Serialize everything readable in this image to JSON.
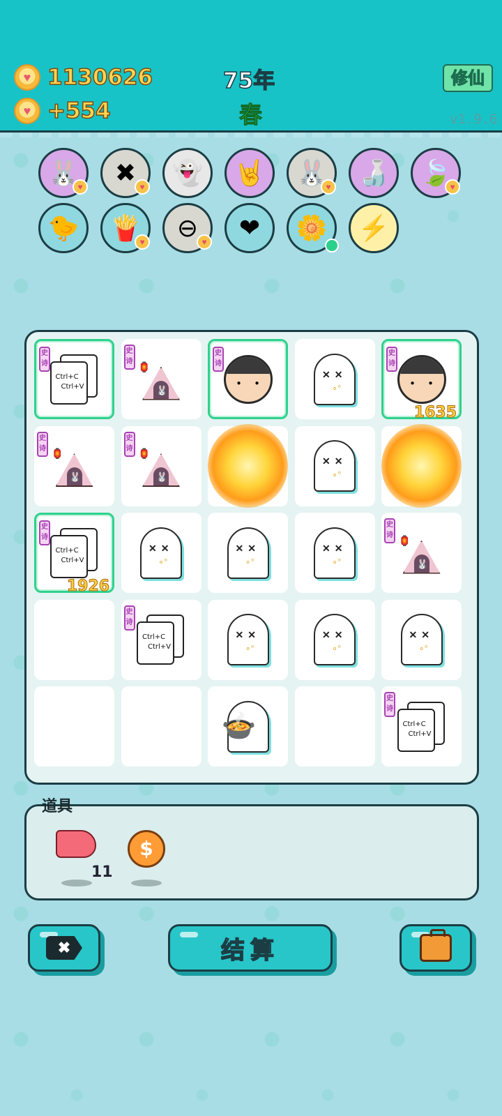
{
  "header": {
    "coins": "1130626",
    "coins_per_turn": "+554",
    "year": "75年",
    "season": "春",
    "mode_button": "修仙",
    "version": "v1.9.6"
  },
  "skills": [
    {
      "name": "rabbit-skill-icon",
      "glyph": "🐰",
      "color": "#d9a8e8",
      "badge": "heart"
    },
    {
      "name": "delete-tag-skill-icon",
      "glyph": "✖",
      "color": "#d8d8d0",
      "badge": "heart"
    },
    {
      "name": "winking-ghost-skill-icon",
      "glyph": "👻",
      "color": "#e8e8e8",
      "badge": "none"
    },
    {
      "name": "rock-hand-skill-icon",
      "glyph": "🤘",
      "color": "#d9a8e8",
      "badge": "none"
    },
    {
      "name": "rabbit-skill-icon-2",
      "glyph": "🐰",
      "color": "#d8d8d0",
      "badge": "heart"
    },
    {
      "name": "milk-jar-skill-icon",
      "glyph": "🍶",
      "color": "#d9a8e8",
      "badge": "none"
    },
    {
      "name": "leaf-skill-icon",
      "glyph": "🍃",
      "color": "#d9a8e8",
      "badge": "heart"
    },
    {
      "name": "duck-pot-skill-icon",
      "glyph": "🐤",
      "color": "#8fd8e0",
      "badge": "none"
    },
    {
      "name": "fries-skill-icon",
      "glyph": "🍟",
      "color": "#8fd8e0",
      "badge": "heart"
    },
    {
      "name": "minus-skill-icon",
      "glyph": "⊖",
      "color": "#d8d8d0",
      "badge": "heart"
    },
    {
      "name": "heart-blood-skill-icon",
      "glyph": "❤",
      "color": "#8fd8e0",
      "badge": "none"
    },
    {
      "name": "flower-pot-skill-icon",
      "glyph": "🌼",
      "color": "#8fd8e0",
      "badge": "dot"
    },
    {
      "name": "lightning-skill-icon",
      "glyph": "⚡",
      "color": "#fff0a8",
      "badge": "none"
    }
  ],
  "board": {
    "tag_text": "史诗",
    "card_line1": "Ctrl+C",
    "card_line2": "Ctrl+V",
    "cells": [
      {
        "type": "cards",
        "tag": true,
        "highlight": true,
        "num": ""
      },
      {
        "type": "tent",
        "tag": true,
        "highlight": false,
        "num": ""
      },
      {
        "type": "face",
        "tag": true,
        "highlight": true,
        "num": ""
      },
      {
        "type": "ghost",
        "tag": false,
        "highlight": false,
        "num": ""
      },
      {
        "type": "face",
        "tag": true,
        "highlight": true,
        "num": "1635"
      },
      {
        "type": "tent",
        "tag": true,
        "highlight": false,
        "num": ""
      },
      {
        "type": "tent",
        "tag": true,
        "highlight": false,
        "num": ""
      },
      {
        "type": "blast",
        "tag": false,
        "highlight": false,
        "num": ""
      },
      {
        "type": "ghost",
        "tag": false,
        "highlight": false,
        "num": ""
      },
      {
        "type": "blast",
        "tag": false,
        "highlight": false,
        "num": ""
      },
      {
        "type": "cards",
        "tag": true,
        "highlight": true,
        "num": "1926"
      },
      {
        "type": "ghost",
        "tag": false,
        "highlight": false,
        "num": ""
      },
      {
        "type": "ghost",
        "tag": false,
        "highlight": false,
        "num": ""
      },
      {
        "type": "ghost",
        "tag": false,
        "highlight": false,
        "num": ""
      },
      {
        "type": "tent",
        "tag": true,
        "highlight": false,
        "num": ""
      },
      {
        "type": "empty",
        "tag": false,
        "highlight": false,
        "num": ""
      },
      {
        "type": "cards",
        "tag": true,
        "highlight": false,
        "num": ""
      },
      {
        "type": "ghost",
        "tag": false,
        "highlight": false,
        "num": ""
      },
      {
        "type": "ghost",
        "tag": false,
        "highlight": false,
        "num": ""
      },
      {
        "type": "ghost",
        "tag": false,
        "highlight": false,
        "num": ""
      },
      {
        "type": "empty",
        "tag": false,
        "highlight": false,
        "num": ""
      },
      {
        "type": "empty",
        "tag": false,
        "highlight": false,
        "num": ""
      },
      {
        "type": "pot-ghost",
        "tag": false,
        "highlight": false,
        "num": ""
      },
      {
        "type": "empty",
        "tag": false,
        "highlight": false,
        "num": ""
      },
      {
        "type": "cards",
        "tag": true,
        "highlight": false,
        "num": ""
      }
    ]
  },
  "items": {
    "title": "道具",
    "liver_count": "11",
    "coin_symbol": "$"
  },
  "buttons": {
    "delete_icon": "x-tag-icon",
    "settle_label": "结算",
    "bag_icon": "briefcase-icon"
  },
  "colors": {
    "topbar": "#18c3c7",
    "background": "#a9dde6",
    "accent_button": "#28c6c9",
    "highlight_border": "#2fd18d",
    "epic_tag": "#a842b4"
  }
}
